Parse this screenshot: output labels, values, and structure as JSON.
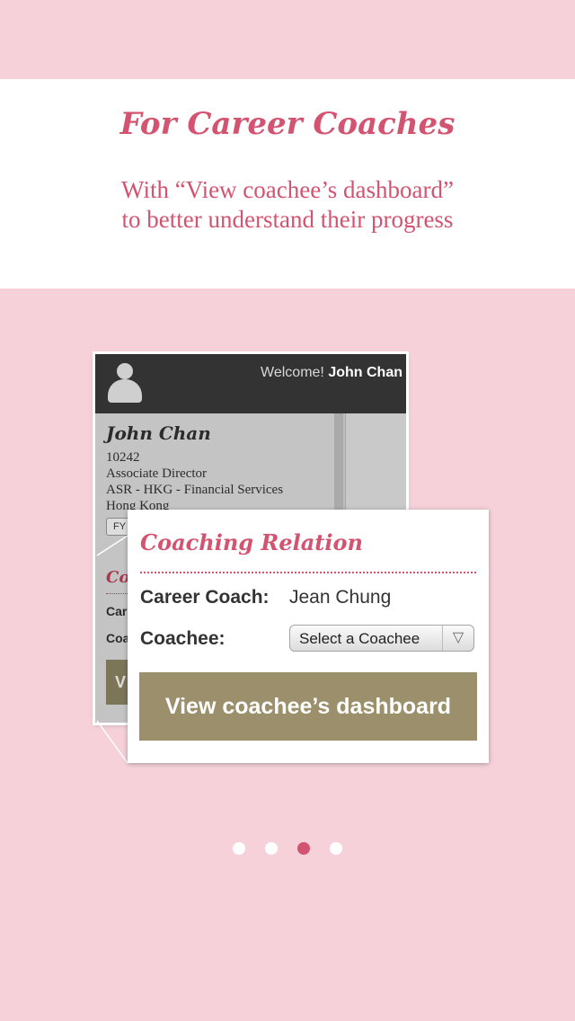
{
  "header": {
    "title": "For Career Coaches",
    "subtitle_line1": "With “View coachee’s dashboard”",
    "subtitle_line2": "to better understand their progress"
  },
  "background_screen": {
    "welcome_prefix": "Welcome!",
    "welcome_name": "John Chan",
    "profile_name": "John Chan",
    "details": [
      "10242",
      "Associate Director",
      "ASR - HKG - Financial Services",
      "Hong Kong"
    ],
    "fy_badge": "FY",
    "section_partial": "Co",
    "row1_partial": "Car",
    "row2_partial": "Coa",
    "button_partial": "V"
  },
  "card": {
    "title": "Coaching Relation",
    "career_coach_label": "Career Coach:",
    "career_coach_value": "Jean Chung",
    "coachee_label": "Coachee:",
    "coachee_select_value": "Select a Coachee",
    "dropdown_glyph": "▽",
    "dashboard_button_label": "View coachee’s dashboard"
  },
  "pagination": {
    "total": 4,
    "current": 3
  },
  "colors": {
    "accent": "#d35470",
    "page_background": "#f6d1d9",
    "button": "#9b8f6c"
  }
}
